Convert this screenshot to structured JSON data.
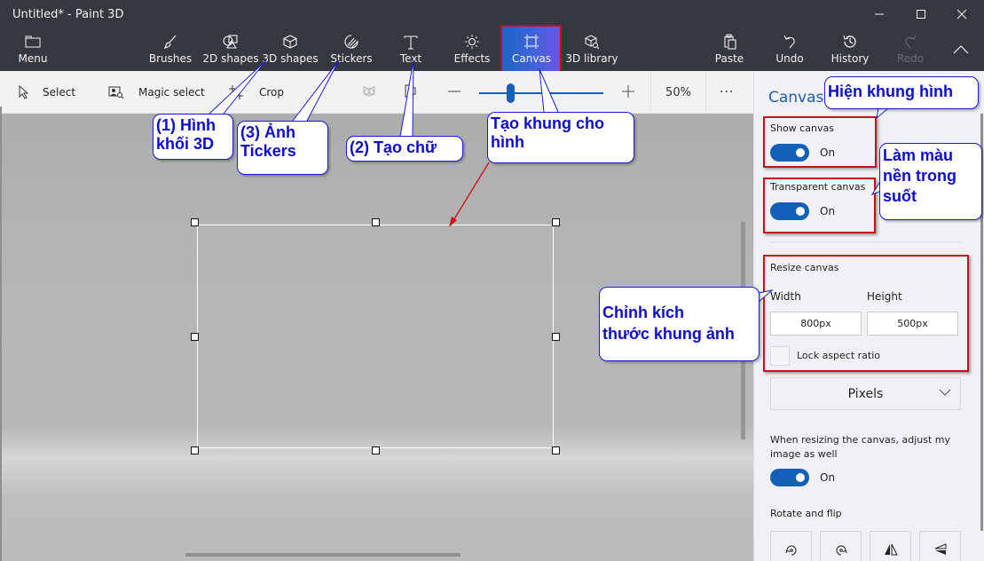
{
  "window": {
    "title": "Untitled* - Paint 3D",
    "controls": {
      "minimize": "—",
      "maximize": "☐",
      "close": "✕"
    }
  },
  "ribbon": {
    "menu": "Menu",
    "tabs": [
      {
        "label": "Brushes",
        "icon": "brush-icon"
      },
      {
        "label": "2D shapes",
        "icon": "2d-shapes-icon"
      },
      {
        "label": "3D shapes",
        "icon": "3d-cube-icon"
      },
      {
        "label": "Stickers",
        "icon": "sticker-icon"
      },
      {
        "label": "Text",
        "icon": "text-icon"
      },
      {
        "label": "Effects",
        "icon": "sun-icon"
      },
      {
        "label": "Canvas",
        "icon": "canvas-icon",
        "selected": true
      },
      {
        "label": "3D library",
        "icon": "3d-library-icon"
      }
    ],
    "actions": [
      {
        "label": "Paste",
        "icon": "paste-icon",
        "enabled": true
      },
      {
        "label": "Undo",
        "icon": "undo-icon",
        "enabled": true
      },
      {
        "label": "History",
        "icon": "history-icon",
        "enabled": true
      },
      {
        "label": "Redo",
        "icon": "redo-icon",
        "enabled": false
      }
    ],
    "collapse": "^"
  },
  "toolbar": {
    "select": "Select",
    "magic_select": "Magic select",
    "crop": "Crop",
    "zoom_minus": "—",
    "zoom_plus": "+",
    "zoom_percent": "50%",
    "zoom_fraction": 0.25,
    "more": "···"
  },
  "panel": {
    "title": "Canvas",
    "show_canvas": {
      "label": "Show canvas",
      "state": "On"
    },
    "transparent_canvas": {
      "label": "Transparent canvas",
      "state": "On"
    },
    "resize": {
      "label": "Resize canvas",
      "width_label": "Width",
      "height_label": "Height",
      "width_value": "800px",
      "height_value": "500px",
      "lock_label": "Lock aspect ratio",
      "lock_checked": false
    },
    "units": "Pixels",
    "adjust_image": {
      "label": "When resizing the canvas, adjust my image as well",
      "state": "On"
    },
    "rotate_flip": {
      "label": "Rotate and flip",
      "buttons": [
        "rotate-left-icon",
        "rotate-right-icon",
        "flip-horizontal-icon",
        "flip-vertical-icon"
      ]
    }
  },
  "annotations": {
    "shapes_3d": "(1) Hình\nkhối 3D",
    "stickers": "(3) Ảnh\nTickers",
    "text": "(2) Tạo chữ",
    "canvas": "Tạo khung cho\nhình",
    "show_canvas": "Hiện khung hình",
    "transparent": "Làm màu\nnền trong\nsuốt",
    "resize": "Chỉnh kích\nthước khung ảnh"
  },
  "colors": {
    "accent": "#1460b8",
    "ribbon_bg": "#363840",
    "annotation_red": "#c0121b",
    "annotation_blue": "#0c0ccc"
  }
}
